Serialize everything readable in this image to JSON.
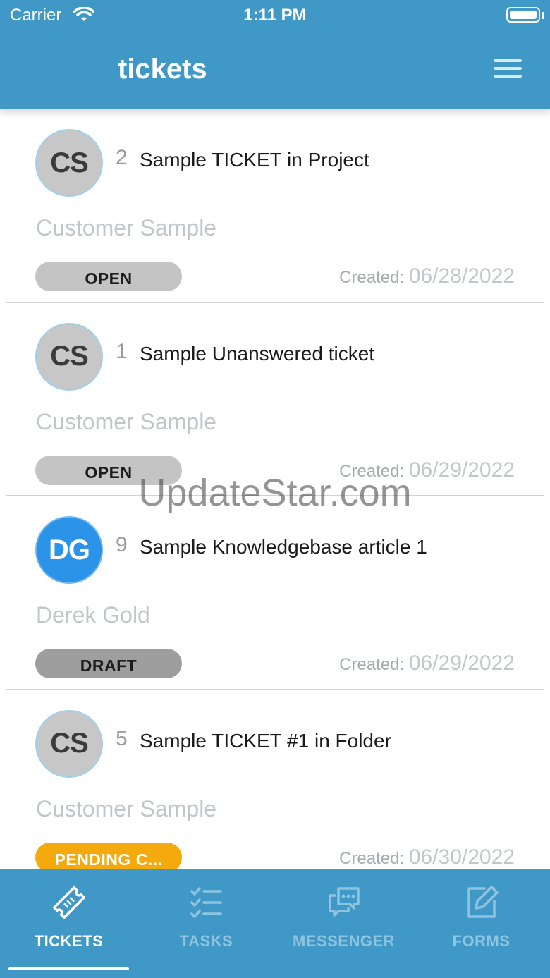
{
  "status_bar": {
    "carrier": "Carrier",
    "time": "1:11 PM"
  },
  "header": {
    "title": "tickets"
  },
  "tickets": [
    {
      "initials": "CS",
      "number": "2",
      "subject": "Sample TICKET in Project",
      "customer": "Customer Sample",
      "status": "OPEN",
      "created_label": "Created:",
      "created_date": "06/28/2022"
    },
    {
      "initials": "CS",
      "number": "1",
      "subject": "Sample Unanswered ticket",
      "customer": "Customer Sample",
      "status": "OPEN",
      "created_label": "Created:",
      "created_date": "06/29/2022"
    },
    {
      "initials": "DG",
      "number": "9",
      "subject": "Sample Knowledgebase article 1",
      "customer": "Derek Gold",
      "status": "DRAFT",
      "created_label": "Created:",
      "created_date": "06/29/2022"
    },
    {
      "initials": "CS",
      "number": "5",
      "subject": "Sample TICKET #1 in Folder",
      "customer": "Customer Sample",
      "status": "PENDING C...",
      "created_label": "Created:",
      "created_date": "06/30/2022"
    }
  ],
  "watermark": "UpdateStar.com",
  "tabs": [
    {
      "label": "TICKETS",
      "icon": "ticket-icon"
    },
    {
      "label": "TASKS",
      "icon": "checklist-icon"
    },
    {
      "label": "MESSENGER",
      "icon": "chat-bubbles-icon"
    },
    {
      "label": "FORMS",
      "icon": "edit-form-icon"
    }
  ],
  "colors": {
    "brand": "#3f98c6",
    "pending": "#f4a90d",
    "avatar_blue": "#2b94e8"
  }
}
